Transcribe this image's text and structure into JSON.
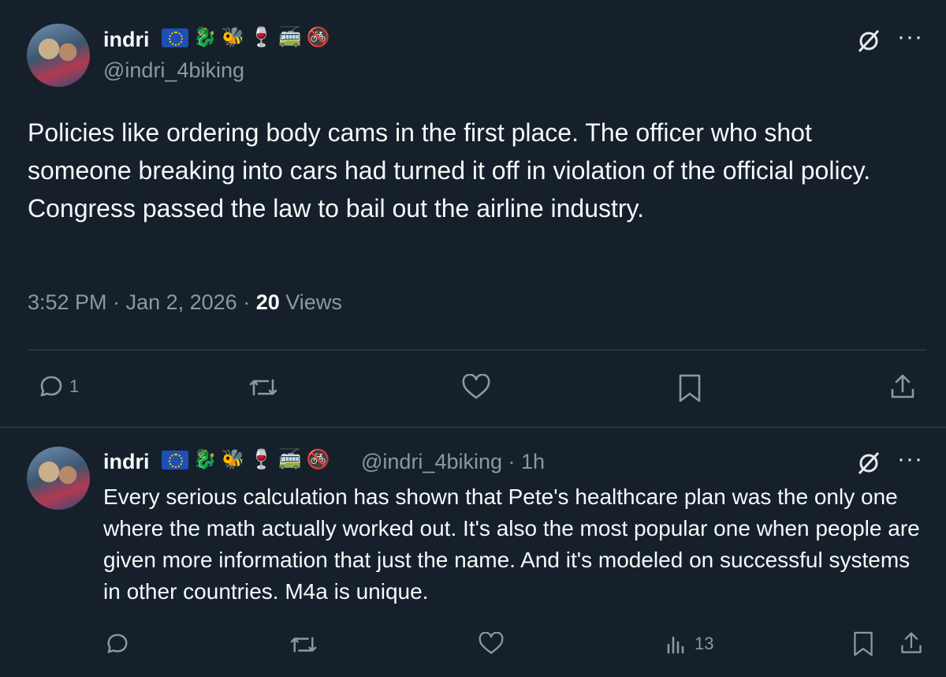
{
  "main_tweet": {
    "author_name": "indri",
    "author_emojis": [
      "eu-flag",
      "🐉",
      "🐝",
      "🍷",
      "🚎",
      "🚳"
    ],
    "handle": "@indri_4biking",
    "text_lines": [
      "Policies like ordering body cams in the first place. The officer who shot someone breaking into cars had turned it off in violation of the official policy.",
      "Congress passed the law to bail out the airline industry."
    ],
    "time": "3:52 PM",
    "date": "Jan 2, 2026",
    "views_count": "20",
    "views_label": "Views",
    "reply_count": "1",
    "more_label": "···"
  },
  "reply_tweet": {
    "author_name": "indri",
    "author_emojis": [
      "eu-flag",
      "🐉",
      "🐝",
      "🍷",
      "🚎",
      "🚳"
    ],
    "handle_time": "@indri_4biking · 1h",
    "text": "Every serious calculation has shown that Pete's healthcare plan was the only one where the math actually worked out. It's also the most popular one when people are given more information that just the name. And it's modeled on successful systems in other countries. M4a is unique.",
    "views_count": "13",
    "more_label": "···"
  },
  "colors": {
    "background": "#15202b",
    "text": "#f7f9f9",
    "secondary": "#8b98a5",
    "divider": "#38444d"
  }
}
